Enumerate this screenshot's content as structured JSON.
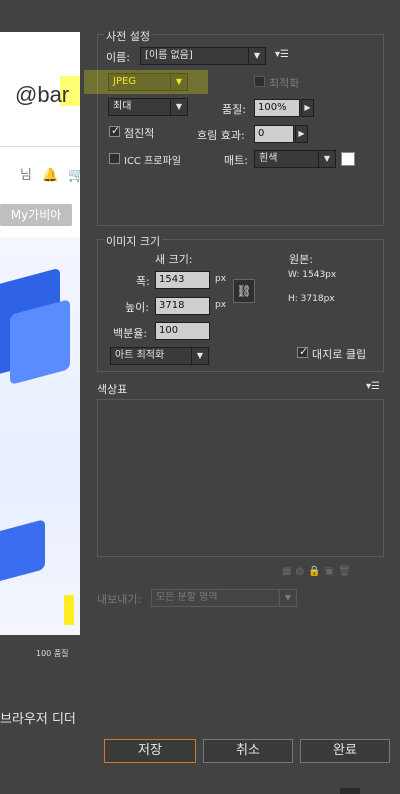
{
  "preview": {
    "search_text": "@bar",
    "my_button": "My가비아",
    "icons_text": "님 🔔 🛒",
    "zoom_caption": "100 품질"
  },
  "browser_dither": "브라우저 디더",
  "preset": {
    "group_title": "사전 설정",
    "name_label": "이름:",
    "name_value": "[이름 없음]",
    "format_value": "JPEG",
    "optimize_label": "최적화",
    "quality_level": "최대",
    "quality_label": "품질:",
    "quality_value": "100%",
    "progressive_label": "점진적",
    "blur_label": "흐림 효과:",
    "blur_value": "0",
    "icc_label": "ICC 프로파일",
    "matte_label": "매트:",
    "matte_value": "흰색",
    "matte_color": "#ffffff"
  },
  "image_size": {
    "group_title": "이미지 크기",
    "new_size_label": "새 크기:",
    "original_label": "원본:",
    "width_label": "폭:",
    "width_value": "1543",
    "height_label": "높이:",
    "height_value": "3718",
    "unit": "px",
    "percent_label": "백분율:",
    "percent_value": "100",
    "orig_w": "W:  1543px",
    "orig_h": "H:  3718px",
    "resample_value": "아트 최적화",
    "clip_label": "대지로 클립"
  },
  "color_table": {
    "title": "색상표"
  },
  "export": {
    "label": "내보내기:",
    "value": "모든 분할 영역"
  },
  "buttons": {
    "save": "저장",
    "cancel": "취소",
    "done": "완료"
  }
}
